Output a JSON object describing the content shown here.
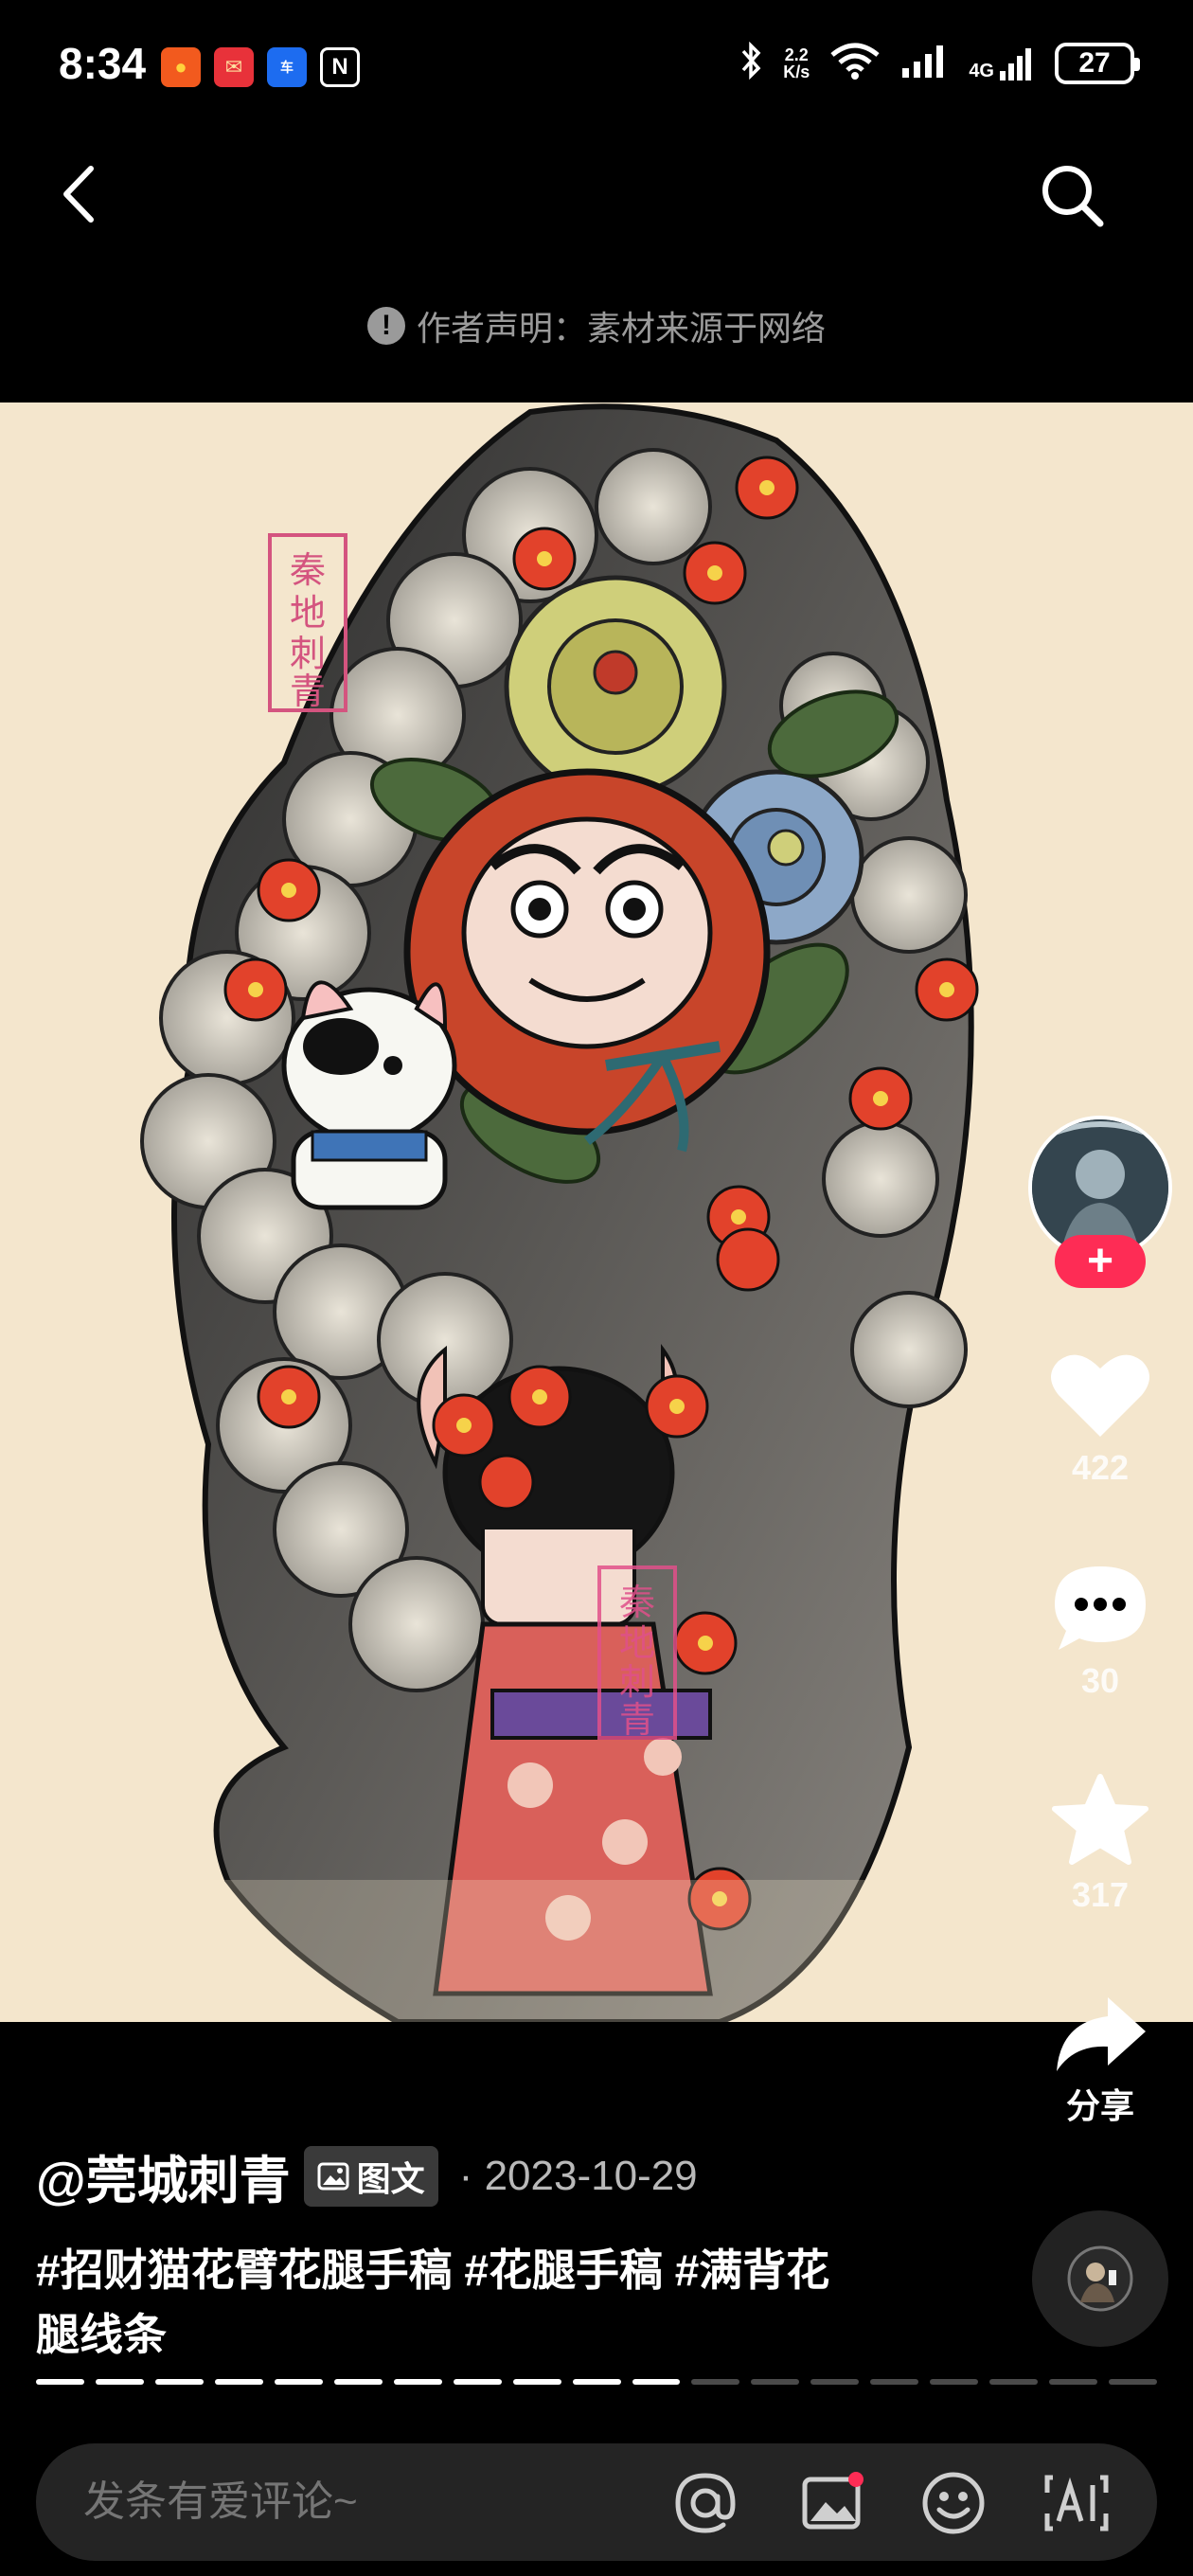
{
  "status_bar": {
    "time": "8:34",
    "network_speed_value": "2.2",
    "network_speed_unit": "K/s",
    "network_type": "4G",
    "battery": "27"
  },
  "header": {
    "disclaimer": "作者声明：素材来源于网络"
  },
  "artwork": {
    "seal_text": "秦地刺青"
  },
  "rail": {
    "likes": "422",
    "comments": "30",
    "favorites": "317",
    "share_label": "分享"
  },
  "post": {
    "author": "@莞城刺青",
    "type_badge": "图文",
    "separator": "·",
    "date": "2023-10-29",
    "description": "#招财猫花臂花腿手稿 #花腿手稿 #满背花腿线条"
  },
  "progress": {
    "total": 19,
    "current": 11
  },
  "comment_bar": {
    "placeholder": "发条有爱评论~"
  },
  "colors": {
    "accent": "#fe2c55",
    "background": "#000000",
    "canvas": "#f4e6cd"
  }
}
